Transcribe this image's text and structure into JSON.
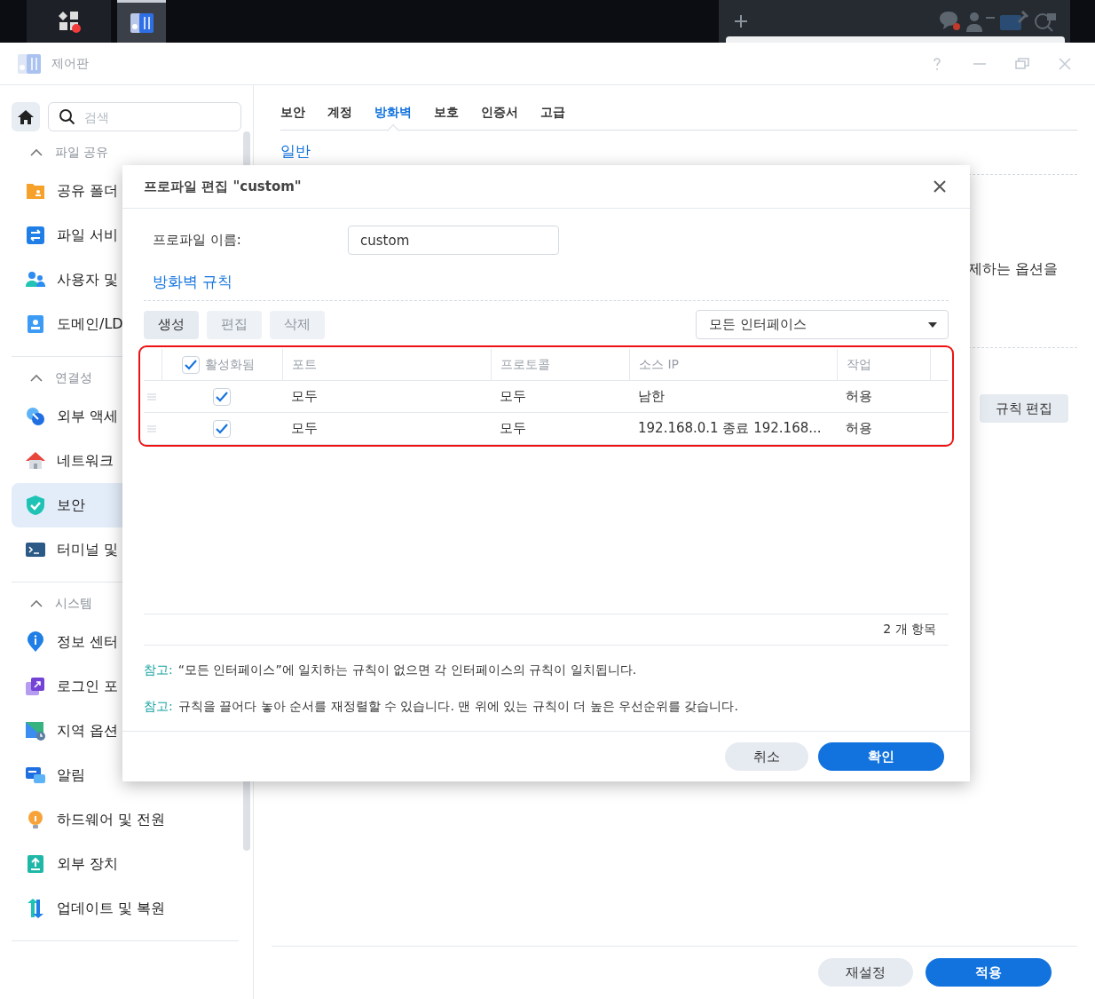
{
  "taskbar": {
    "apps": [
      {
        "selected": false
      },
      {
        "selected": true
      }
    ]
  },
  "window": {
    "title": "제어판"
  },
  "sidebar": {
    "search": {
      "placeholder": "검색"
    },
    "groups": [
      {
        "label": "파일 공유",
        "expanded": true,
        "items": [
          {
            "label": "공유 폴더",
            "selected": false
          },
          {
            "label": "파일 서비",
            "selected": false
          },
          {
            "label": "사용자 및",
            "selected": false
          },
          {
            "label": "도메인/LD",
            "selected": false
          }
        ]
      },
      {
        "label": "연결성",
        "expanded": true,
        "items": [
          {
            "label": "외부 액세",
            "selected": false
          },
          {
            "label": "네트워크",
            "selected": false
          },
          {
            "label": "보안",
            "selected": true
          },
          {
            "label": "터미널 및",
            "selected": false
          }
        ]
      },
      {
        "label": "시스템",
        "expanded": true,
        "items": [
          {
            "label": "정보 센터",
            "selected": false
          },
          {
            "label": "로그인 포",
            "selected": false
          },
          {
            "label": "지역 옵션",
            "selected": false
          },
          {
            "label": "알림",
            "selected": false
          },
          {
            "label": "하드웨어 및 전원",
            "selected": false
          },
          {
            "label": "외부 장치",
            "selected": false
          },
          {
            "label": "업데이트 및 복원",
            "selected": false
          }
        ]
      }
    ]
  },
  "tabs": [
    {
      "label": "보안",
      "selected": false
    },
    {
      "label": "계정",
      "selected": false
    },
    {
      "label": "방화벽",
      "selected": true
    },
    {
      "label": "보호",
      "selected": false
    },
    {
      "label": "인증서",
      "selected": false
    },
    {
      "label": "고급",
      "selected": false
    }
  ],
  "main": {
    "section_title": "일반",
    "description": "제하는 옵션을",
    "edit_rules_button": "규칙 편집",
    "reset_button": "재설정",
    "apply_button": "적용"
  },
  "dialog": {
    "title": "프로파일 편집 \"custom\"",
    "profile_name": {
      "label": "프로파일 이름:",
      "value": "custom"
    },
    "section_title": "방화벽 규칙",
    "toolbar": [
      {
        "label": "생성",
        "disabled": false
      },
      {
        "label": "편집",
        "disabled": true
      },
      {
        "label": "삭제",
        "disabled": true
      }
    ],
    "interface_select": {
      "value": "모든 인터페이스"
    },
    "table": {
      "enabled_column": {
        "label": "활성화됨",
        "checked": true
      },
      "columns": [
        "포트",
        "프로토콜",
        "소스 IP",
        "작업"
      ],
      "rows": [
        {
          "enabled": true,
          "cells": [
            "모두",
            "모두",
            "남한",
            "허용"
          ]
        },
        {
          "enabled": true,
          "cells": [
            "모두",
            "모두",
            "192.168.0.1 종료 192.168...",
            "허용"
          ]
        }
      ]
    },
    "count": "2 개 항목",
    "notes": [
      {
        "label": "참고:",
        "text": "“모든 인터페이스”에 일치하는 규칙이 없으면 각 인터페이스의 규칙이 일치됩니다."
      },
      {
        "label": "참고:",
        "text": "규칙을 끌어다 놓아 순서를 재정렬할 수 있습니다. 맨 위에 있는 규칙이 더 높은 우선순위를 갖습니다."
      }
    ],
    "cancel_button": "취소",
    "ok_button": "확인"
  }
}
